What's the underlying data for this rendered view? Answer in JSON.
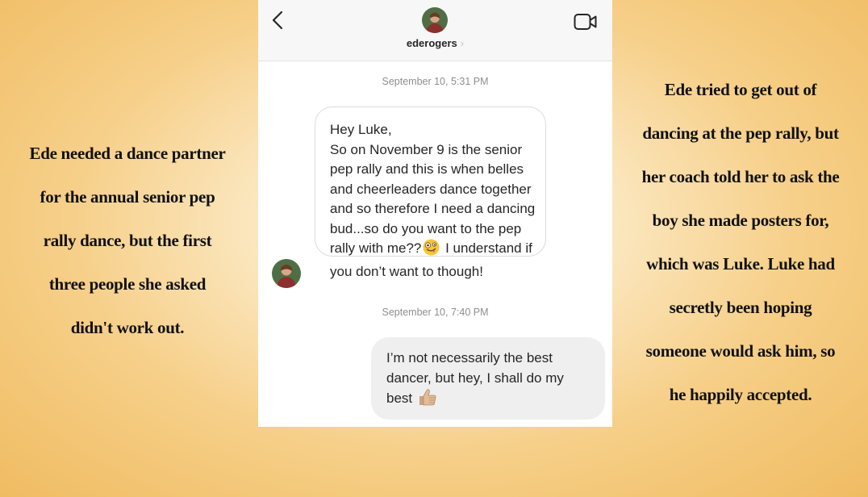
{
  "left_caption": [
    "Ede needed a dance partner",
    "for the annual senior pep",
    "rally dance, but the first",
    "three people she asked",
    "didn't work out."
  ],
  "right_caption": [
    "Ede tried to get out of",
    "dancing at the pep rally, but",
    "her coach told her to ask the",
    "boy she made posters for,",
    "which was Luke. Luke had",
    "secretly been hoping",
    "someone would ask him, so",
    "he happily accepted."
  ],
  "chat": {
    "username": "ederogers",
    "username_chevron": "›",
    "icons": {
      "back": "back-chevron-icon",
      "video": "video-camera-icon",
      "avatar": "profile-avatar",
      "emoji1": "zany-face-emoji",
      "emoji2": "thumbs-up-emoji"
    },
    "messages": [
      {
        "timestamp": "September 10, 5:31 PM",
        "direction": "incoming",
        "lines": [
          "Hey Luke,",
          "So on November 9 is the senior",
          "pep rally and this is when belles",
          "and cheerleaders dance together",
          "and so therefore I need a dancing",
          "bud...so do you want to the pep",
          "rally with me??",
          " I understand if",
          "you don’t want to though!"
        ]
      },
      {
        "timestamp": "September 10, 7:40 PM",
        "direction": "outgoing",
        "lines": [
          "I’m not necessarily the best",
          "dancer, but hey, I shall do my",
          "best"
        ]
      }
    ]
  },
  "colors": {
    "background_center": "#fffaf0",
    "background_edge": "#f0bc62",
    "incoming_bubble_border": "#dbdbdb",
    "outgoing_bubble_fill": "#efefef",
    "timestamp_text": "#8e8e8e"
  }
}
